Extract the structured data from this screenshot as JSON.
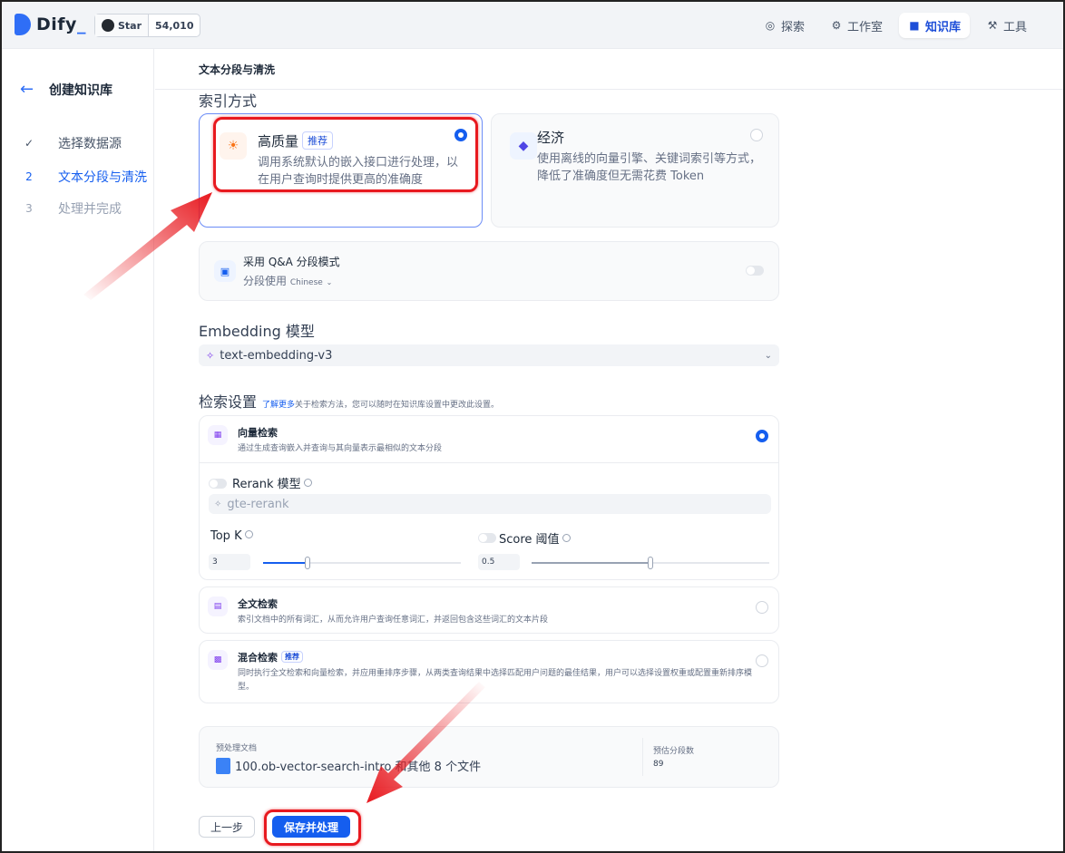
{
  "brand": {
    "name": "Dify",
    "cursor": "_"
  },
  "github": {
    "star_label": "Star",
    "count": "54,010"
  },
  "nav": [
    {
      "label": "探索",
      "icon": "compass-icon"
    },
    {
      "label": "工作室",
      "icon": "robot-icon"
    },
    {
      "label": "知识库",
      "icon": "book-icon",
      "active": true
    },
    {
      "label": "工具",
      "icon": "tool-icon"
    }
  ],
  "sidebar": {
    "title": "创建知识库",
    "steps": [
      {
        "num": "✓",
        "label": "选择数据源",
        "state": "done"
      },
      {
        "num": "2",
        "label": "文本分段与清洗",
        "state": "active"
      },
      {
        "num": "3",
        "label": "处理并完成",
        "state": "todo"
      }
    ]
  },
  "header": {
    "title": "文本分段与清洗"
  },
  "index_method": {
    "title": "索引方式",
    "high_quality": {
      "title": "高质量",
      "badge": "推荐",
      "desc_line1": "调用系统默认的嵌入接口进行处理，以",
      "desc_line2": "在用户查询时提供更高的准确度"
    },
    "economy": {
      "title": "经济",
      "desc_line1": "使用离线的向量引擎、关键词索引等方式，",
      "desc_line2": "降低了准确度但无需花费 Token"
    }
  },
  "qa": {
    "title": "采用 Q&A 分段模式",
    "lang_prefix": "分段使用",
    "lang": "Chinese"
  },
  "embedding": {
    "title": "Embedding 模型",
    "model": "text-embedding-v3"
  },
  "retrieval": {
    "title": "检索设置",
    "learn_more": "了解更多",
    "hint": "关于检索方法，您可以随时在知识库设置中更改此设置。",
    "vector": {
      "title": "向量检索",
      "desc": "通过生成查询嵌入并查询与其向量表示最相似的文本分段"
    },
    "rerank_label": "Rerank 模型",
    "rerank_model": "gte-rerank",
    "topk_label": "Top K",
    "topk_value": "3",
    "score_label": "Score 阈值",
    "score_value": "0.5",
    "fulltext": {
      "title": "全文检索",
      "desc": "索引文档中的所有词汇，从而允许用户查询任意词汇，并返回包含这些词汇的文本片段"
    },
    "hybrid": {
      "title": "混合检索",
      "badge": "推荐",
      "desc_line1": "同时执行全文检索和向量检索，并应用重排序步骤，从两类查询结果中选择匹配用户问题的最佳结果，用户可以选择设置权重或配置重新排序模",
      "desc_line2": "型。"
    }
  },
  "summary": {
    "docs_label": "预处理文档",
    "doc_name": "100.ob-vector-search-intro 和其他 8 个文件",
    "segments_label": "预估分段数",
    "segments_value": "89"
  },
  "actions": {
    "prev": "上一步",
    "save": "保存并处理"
  },
  "colors": {
    "accent": "#155eef",
    "annotation": "#e8191f"
  }
}
